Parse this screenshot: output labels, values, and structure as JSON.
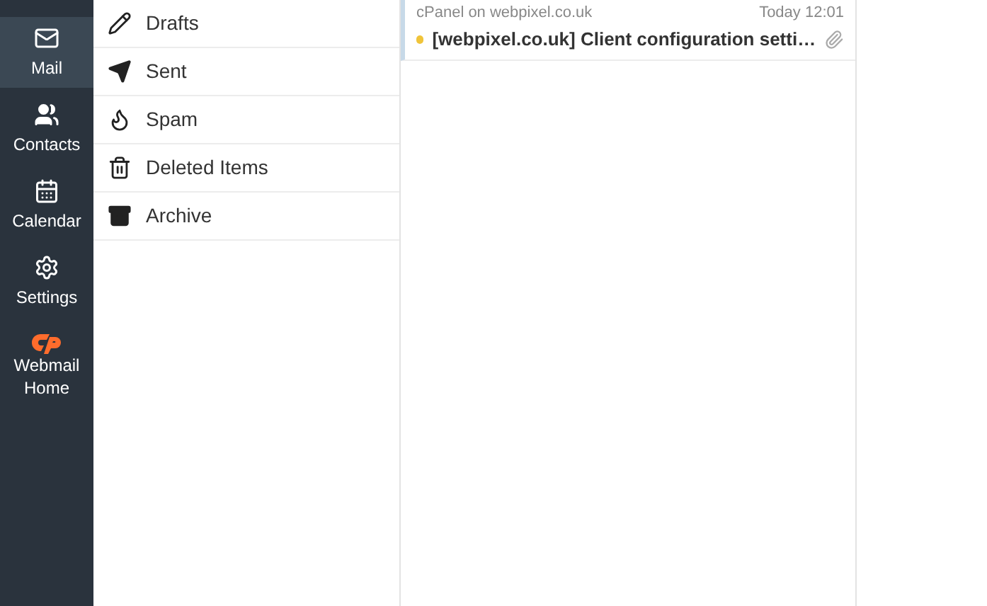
{
  "nav": [
    {
      "kind": "mail",
      "label": "Mail",
      "selected": true
    },
    {
      "kind": "contacts",
      "label": "Contacts",
      "selected": false
    },
    {
      "kind": "calendar",
      "label": "Calendar",
      "selected": false
    },
    {
      "kind": "settings",
      "label": "Settings",
      "selected": false
    },
    {
      "kind": "home",
      "label": "Webmail Home",
      "selected": false
    }
  ],
  "folders": [
    {
      "kind": "drafts",
      "label": "Drafts"
    },
    {
      "kind": "sent",
      "label": "Sent"
    },
    {
      "kind": "spam",
      "label": "Spam"
    },
    {
      "kind": "trash",
      "label": "Deleted Items"
    },
    {
      "kind": "archive",
      "label": "Archive"
    }
  ],
  "messages": [
    {
      "sender": "cPanel on webpixel.co.uk",
      "time": "Today 12:01",
      "subject": "[webpixel.co.uk] Client configuration setti…",
      "unread": true,
      "attachment": true
    }
  ]
}
